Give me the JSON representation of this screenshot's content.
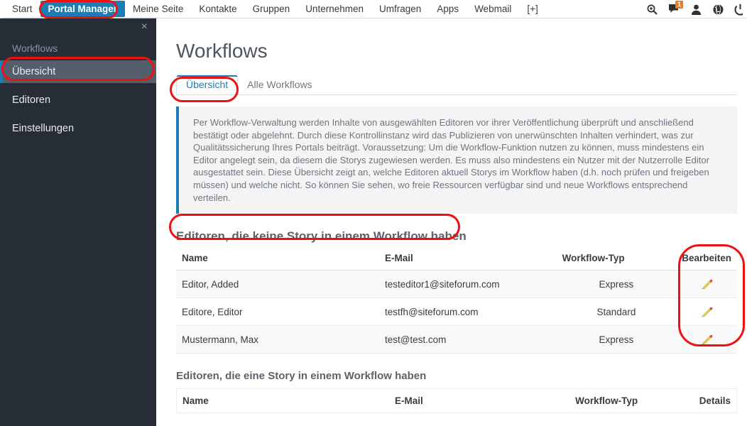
{
  "topnav": {
    "items": [
      {
        "label": "Start",
        "active": false
      },
      {
        "label": "Portal Manager",
        "active": true
      },
      {
        "label": "Meine Seite",
        "active": false
      },
      {
        "label": "Kontakte",
        "active": false
      },
      {
        "label": "Gruppen",
        "active": false
      },
      {
        "label": "Unternehmen",
        "active": false
      },
      {
        "label": "Umfragen",
        "active": false
      },
      {
        "label": "Apps",
        "active": false
      },
      {
        "label": "Webmail",
        "active": false
      },
      {
        "label": "[+]",
        "active": false
      }
    ],
    "icons": [
      {
        "name": "search-icon"
      },
      {
        "name": "message-icon",
        "badge": "1"
      },
      {
        "name": "user-icon"
      },
      {
        "name": "globe-icon"
      },
      {
        "name": "power-icon"
      }
    ],
    "badge_color": "#f07c18",
    "active_color": "#1a7db6"
  },
  "sidebar": {
    "close_label": "×",
    "title": "Workflows",
    "items": [
      {
        "label": "Übersicht",
        "selected": true
      },
      {
        "label": "Editoren",
        "selected": false
      },
      {
        "label": "Einstellungen",
        "selected": false
      }
    ],
    "background": "#262d36",
    "selected_background": "#555e6b",
    "accent": "#1a7db6"
  },
  "main": {
    "page_title": "Workflows",
    "tabs": [
      {
        "label": "Übersicht",
        "active": true
      },
      {
        "label": "Alle Workflows",
        "active": false
      }
    ],
    "info_text": "Per Workflow-Verwaltung werden Inhalte von ausgewählten Editoren vor ihrer Veröffentlichung überprüft und anschließend bestätigt oder abgelehnt. Durch diese Kontrollinstanz wird das Publizieren von unerwünschten Inhalten verhindert, was zur Qualitätssicherung Ihres Portals beiträgt. Voraussetzung: Um die Workflow-Funktion nutzen zu können, muss mindestens ein Editor angelegt sein, da diesem die Storys zugewiesen werden. Es muss also mindestens ein Nutzer mit der Nutzerrolle Editor ausgestattet sein. Diese Übersicht zeigt an, welche Editoren aktuell Storys im Workflow haben (d.h. noch prüfen und freigeben müssen) und welche nicht. So können Sie sehen, wo freie Ressourcen verfügbar sind und neue Workflows entsprechend verteilen.",
    "info_accent": "#1a7db6",
    "section_no_story": {
      "title": "Editoren, die keine Story in einem Workflow haben",
      "columns": [
        "Name",
        "E-Mail",
        "Workflow-Typ",
        "Bearbeiten"
      ],
      "rows": [
        {
          "name": "Editor, Added",
          "email": "testeditor1@siteforum.com",
          "type": "Express",
          "action_icon": "pencil-icon"
        },
        {
          "name": "Editore, Editor",
          "email": "testfh@siteforum.com",
          "type": "Standard",
          "action_icon": "pencil-icon"
        },
        {
          "name": "Mustermann, Max",
          "email": "test@test.com",
          "type": "Express",
          "action_icon": "pencil-icon"
        }
      ]
    },
    "section_with_story": {
      "title": "Editoren, die eine Story in einem Workflow haben",
      "columns": [
        "Name",
        "E-Mail",
        "Workflow-Typ",
        "Details"
      ],
      "rows": []
    }
  },
  "annotations": {
    "color": "#ee1111",
    "highlights": [
      "portal-manager-nav-item",
      "sidebar-item-uebersicht",
      "tab-uebersicht",
      "section-title-no-story",
      "bearbeiten-column"
    ]
  }
}
